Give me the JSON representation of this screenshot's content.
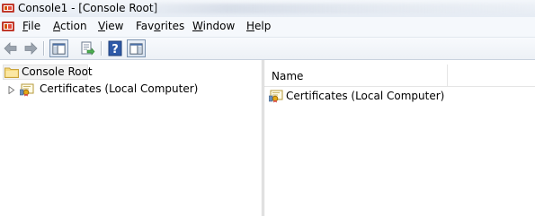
{
  "window": {
    "title": "Console1 - [Console Root]"
  },
  "menu": [
    {
      "label": "File",
      "accel": "F",
      "rest": "ile"
    },
    {
      "label": "Action",
      "accel": "A",
      "rest": "ction"
    },
    {
      "label": "View",
      "accel": "V",
      "rest": "iew"
    },
    {
      "label": "Favorites",
      "accel": "o",
      "pre": "Fav",
      "rest": "rites"
    },
    {
      "label": "Window",
      "accel": "W",
      "rest": "indow"
    },
    {
      "label": "Help",
      "accel": "H",
      "rest": "elp"
    }
  ],
  "toolbar": {
    "buttons": [
      "back-icon",
      "forward-icon",
      "show-hide-console-tree-icon",
      "export-list-icon",
      "help-icon",
      "show-hide-action-pane-icon"
    ]
  },
  "tree": {
    "root_label": "Console Root",
    "child_label": "Certificates (Local Computer)"
  },
  "list": {
    "column_name": "Name",
    "items": [
      "Certificates (Local Computer)"
    ]
  },
  "colors": {
    "toolbar_bg": "#edf1f6",
    "menubar_bg": "#f5f8fc",
    "selection_bg": "#f2f2f2"
  }
}
